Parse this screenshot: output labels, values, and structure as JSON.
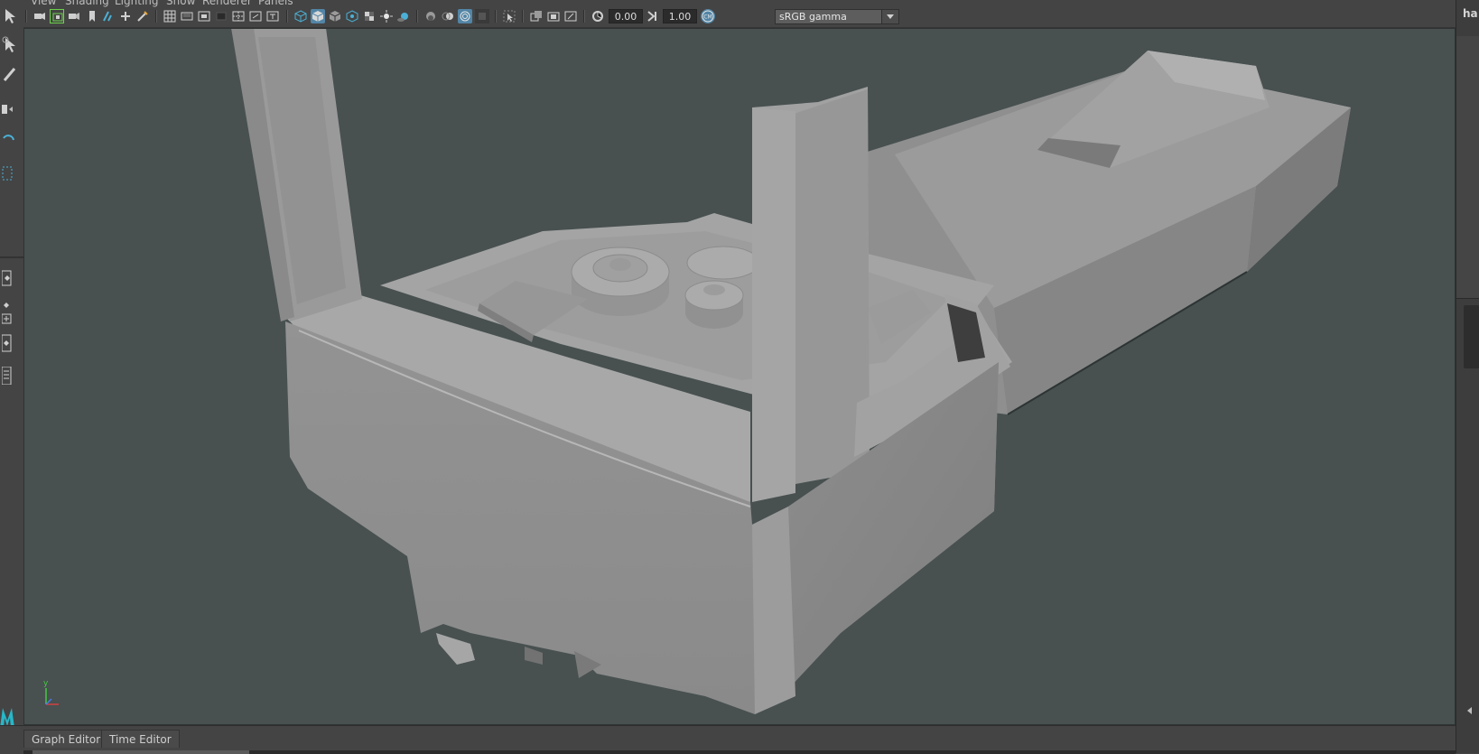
{
  "menu": {
    "items": [
      "View",
      "Shading",
      "Lighting",
      "Show",
      "Renderer",
      "Panels"
    ]
  },
  "toolbar": {
    "exposure_value": "0.00",
    "gamma_value": "1.00",
    "color_management": {
      "selected": "sRGB gamma"
    },
    "icons": [
      "camera-icon",
      "camera-attributes-icon",
      "bookmark-icon",
      "image-plane-icon",
      "grid-icon",
      "film-gate-icon",
      "resolution-gate-icon",
      "gate-mask-icon",
      "field-chart-icon",
      "safe-action-icon",
      "safe-title-icon",
      "wireframe-icon",
      "smooth-shade-icon",
      "wireframe-on-shaded-icon",
      "textured-icon",
      "checker-icon",
      "lights-icon",
      "shadows-icon",
      "screen-space-ao-icon",
      "motion-blur-icon",
      "anti-aliasing-icon",
      "depth-of-field-icon",
      "isolate-select-icon",
      "xray-icon",
      "xray-active-icon",
      "xray-joints-icon",
      "exposure-icon",
      "gamma-icon",
      "color-management-icon"
    ]
  },
  "left_tools": [
    "select-tool-icon",
    "lasso-tool-icon",
    "paint-select-icon",
    "move-tool-icon",
    "rotate-tool-icon",
    "scale-tool-icon",
    "layout-single-icon",
    "layout-four-icon",
    "layout-add-icon",
    "layout-outliner-icon",
    "layout-list-icon"
  ],
  "right_strip": {
    "partial_text": "ha"
  },
  "axis_indicator": {
    "y_label": "y",
    "x_label": "x",
    "z_label": "z"
  },
  "bottom_tabs": [
    {
      "label": "Graph Editor"
    },
    {
      "label": "Time Editor"
    }
  ],
  "colors": {
    "viewport_bg": "#485050",
    "ui_bg": "#444444",
    "active_icon": "#5285a6",
    "model_gray": "#9a9a9a"
  }
}
